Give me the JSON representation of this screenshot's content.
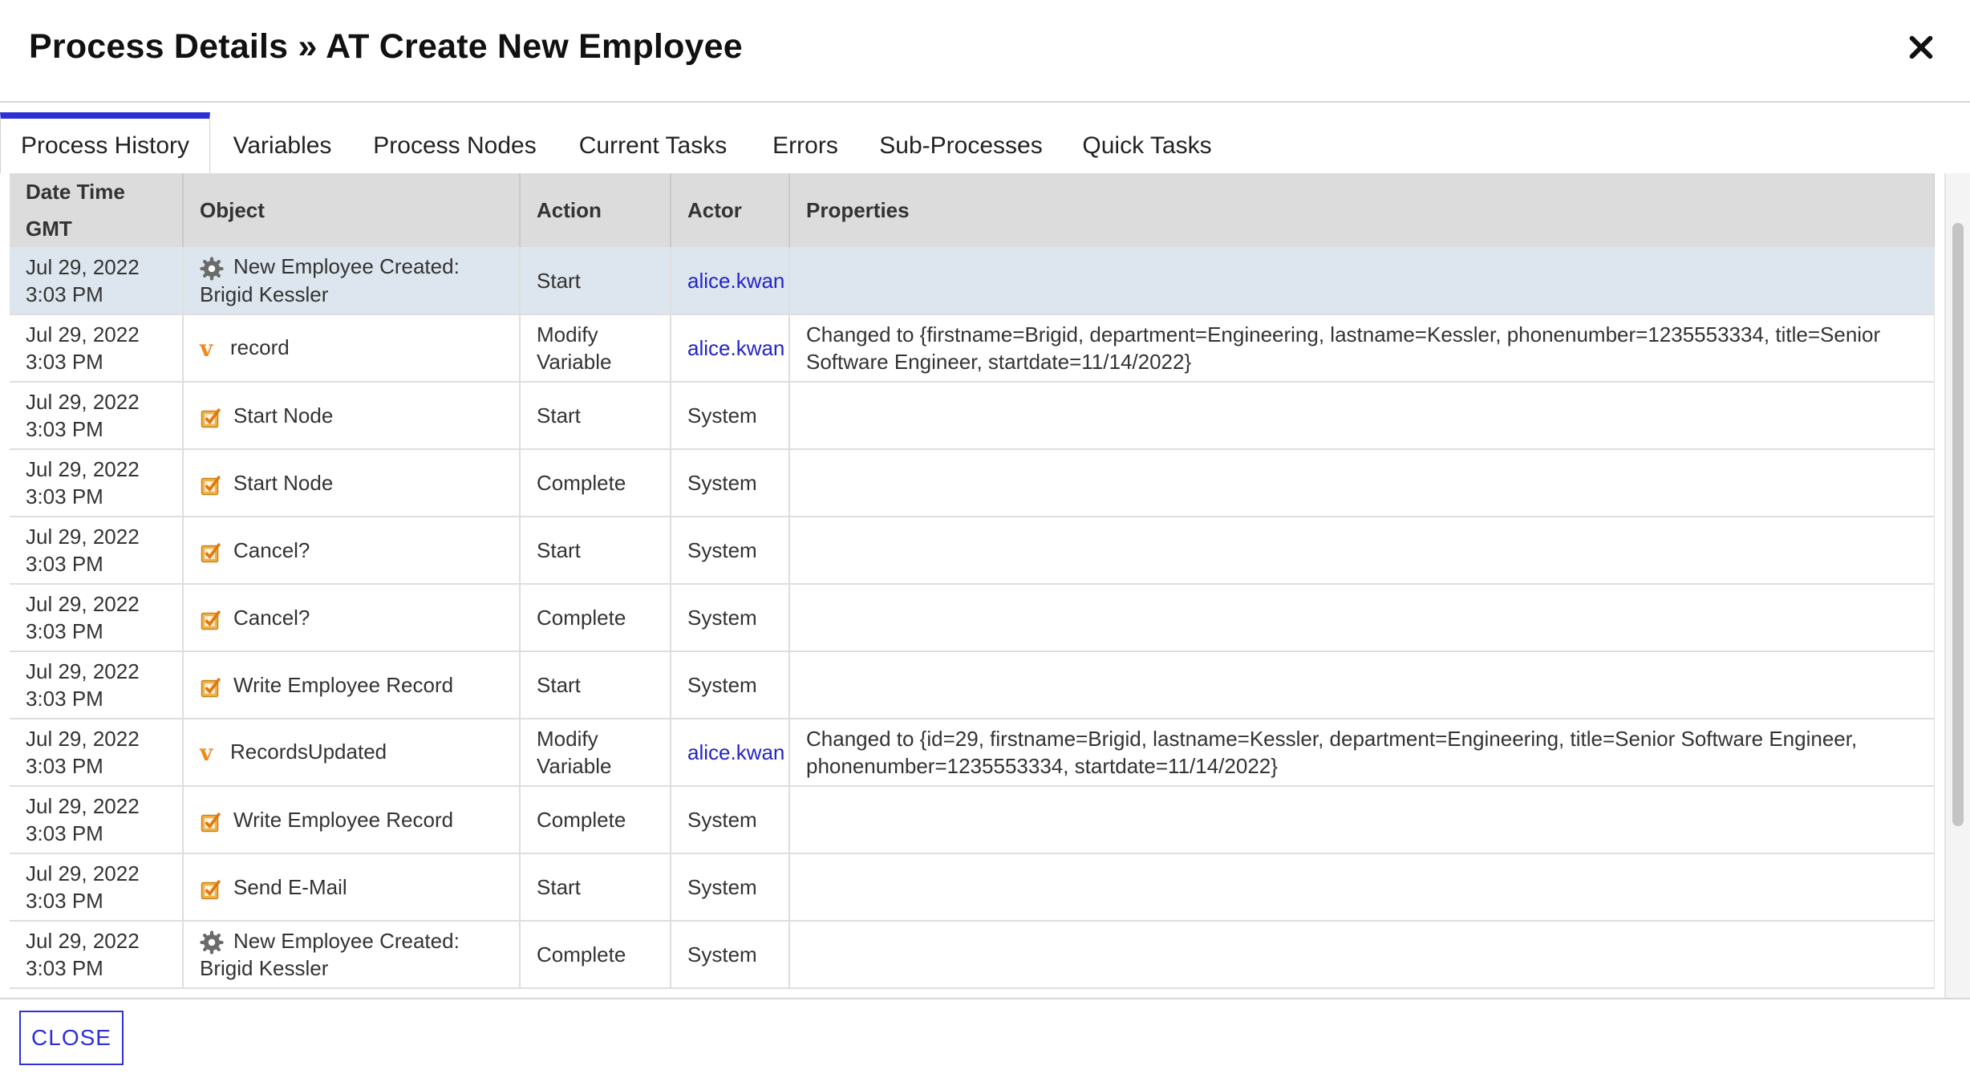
{
  "dialog": {
    "title": "Process Details » AT Create New Employee",
    "close_icon": "close-icon"
  },
  "tabs": [
    {
      "label": "Process History",
      "active": true
    },
    {
      "label": "Variables"
    },
    {
      "label": "Process Nodes"
    },
    {
      "label": "Current Tasks"
    },
    {
      "label": "Errors"
    },
    {
      "label": "Sub-Processes"
    },
    {
      "label": "Quick Tasks"
    }
  ],
  "table": {
    "headers": {
      "date_line1": "Date Time",
      "date_line2": "GMT",
      "object": "Object",
      "action": "Action",
      "actor": "Actor",
      "properties": "Properties"
    },
    "rows": [
      {
        "datetime": "Jul 29, 2022 3:03 PM",
        "icon": "gear-icon",
        "object": "New Employee Created: Brigid Kessler",
        "action": "Start",
        "actor": "alice.kwan",
        "actor_link": true,
        "properties": "",
        "selected": true
      },
      {
        "datetime": "Jul 29, 2022 3:03 PM",
        "icon": "variable-icon",
        "object": "record",
        "action": "Modify Variable",
        "actor": "alice.kwan",
        "actor_link": true,
        "properties": "Changed to {firstname=Brigid, department=Engineering, lastname=Kessler, phonenumber=1235553334, title=Senior Software Engineer, startdate=11/14/2022}"
      },
      {
        "datetime": "Jul 29, 2022 3:03 PM",
        "icon": "task-icon",
        "object": "Start Node",
        "action": "Start",
        "actor": "System",
        "properties": ""
      },
      {
        "datetime": "Jul 29, 2022 3:03 PM",
        "icon": "task-icon",
        "object": "Start Node",
        "action": "Complete",
        "actor": "System",
        "properties": ""
      },
      {
        "datetime": "Jul 29, 2022 3:03 PM",
        "icon": "task-icon",
        "object": "Cancel?",
        "action": "Start",
        "actor": "System",
        "properties": ""
      },
      {
        "datetime": "Jul 29, 2022 3:03 PM",
        "icon": "task-icon",
        "object": "Cancel?",
        "action": "Complete",
        "actor": "System",
        "properties": ""
      },
      {
        "datetime": "Jul 29, 2022 3:03 PM",
        "icon": "task-icon",
        "object": "Write Employee Record",
        "action": "Start",
        "actor": "System",
        "properties": ""
      },
      {
        "datetime": "Jul 29, 2022 3:03 PM",
        "icon": "variable-icon",
        "object": "RecordsUpdated",
        "action": "Modify Variable",
        "actor": "alice.kwan",
        "actor_link": true,
        "properties": "Changed to {id=29, firstname=Brigid, lastname=Kessler, department=Engineering, title=Senior Software Engineer, phonenumber=1235553334, startdate=11/14/2022}"
      },
      {
        "datetime": "Jul 29, 2022 3:03 PM",
        "icon": "task-icon",
        "object": "Write Employee Record",
        "action": "Complete",
        "actor": "System",
        "properties": ""
      },
      {
        "datetime": "Jul 29, 2022 3:03 PM",
        "icon": "task-icon",
        "object": "Send E-Mail",
        "action": "Start",
        "actor": "System",
        "properties": ""
      },
      {
        "datetime": "Jul 29, 2022 3:03 PM",
        "icon": "gear-icon",
        "object": "New Employee Created: Brigid Kessler",
        "action": "Complete",
        "actor": "System",
        "properties": ""
      }
    ]
  },
  "footer": {
    "close_label": "CLOSE"
  },
  "colors": {
    "accent": "#2f2fd6",
    "link": "#2424c8",
    "header_bg": "#dcdcdc",
    "selected_row": "#dde6ee",
    "variable_icon": "#f08a18"
  }
}
